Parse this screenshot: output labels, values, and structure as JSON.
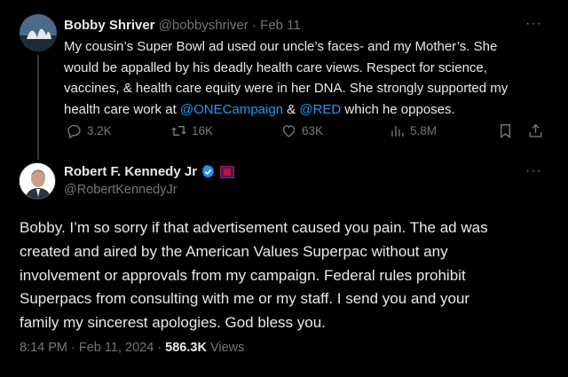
{
  "parent_tweet": {
    "author_name": "Bobby Shriver",
    "handle": "@bobbyshriver",
    "separator": "·",
    "date": "Feb 11",
    "more": "···",
    "text_lines": [
      "My cousin’s Super Bowl ad used our uncle’s faces- and my Mother’s. She",
      "would be appalled by his deadly health care views.  Respect for science,",
      "vaccines, & health care equity were in her DNA. She strongly supported my"
    ],
    "last_line": {
      "before": "health care work at ",
      "mention1": "@ONECampaign",
      "middle": " & ",
      "mention2": "@RED",
      "after": " which he opposes."
    },
    "actions": {
      "replies": "3.2K",
      "reposts": "16K",
      "likes": "63K",
      "views": "5.8M"
    }
  },
  "main_tweet": {
    "author_name": "Robert F. Kennedy Jr",
    "handle": "@RobertKennedyJr",
    "more": "···",
    "text_lines": [
      "Bobby. I’m so sorry if that advertisement caused you pain. The ad was",
      "created and aired by the American Values Superpac without any",
      "involvement or approvals from my campaign. Federal rules prohibit",
      "Superpacs from consulting with me or my staff. I send you and your",
      "family my sincerest apologies. God bless you."
    ],
    "timestamp": "8:14 PM · Feb 11, 2024 · ",
    "views_count": "586.3K",
    "views_label": " Views"
  },
  "colors": {
    "background": "#000000",
    "text": "#e7e9ea",
    "secondary": "#71767b",
    "link": "#1d9bf0",
    "verified": "#1d9bf0"
  },
  "icons": [
    "reply-icon",
    "repost-icon",
    "like-icon",
    "views-icon",
    "bookmark-icon",
    "share-icon",
    "verified-badge-icon",
    "flag-icon"
  ]
}
